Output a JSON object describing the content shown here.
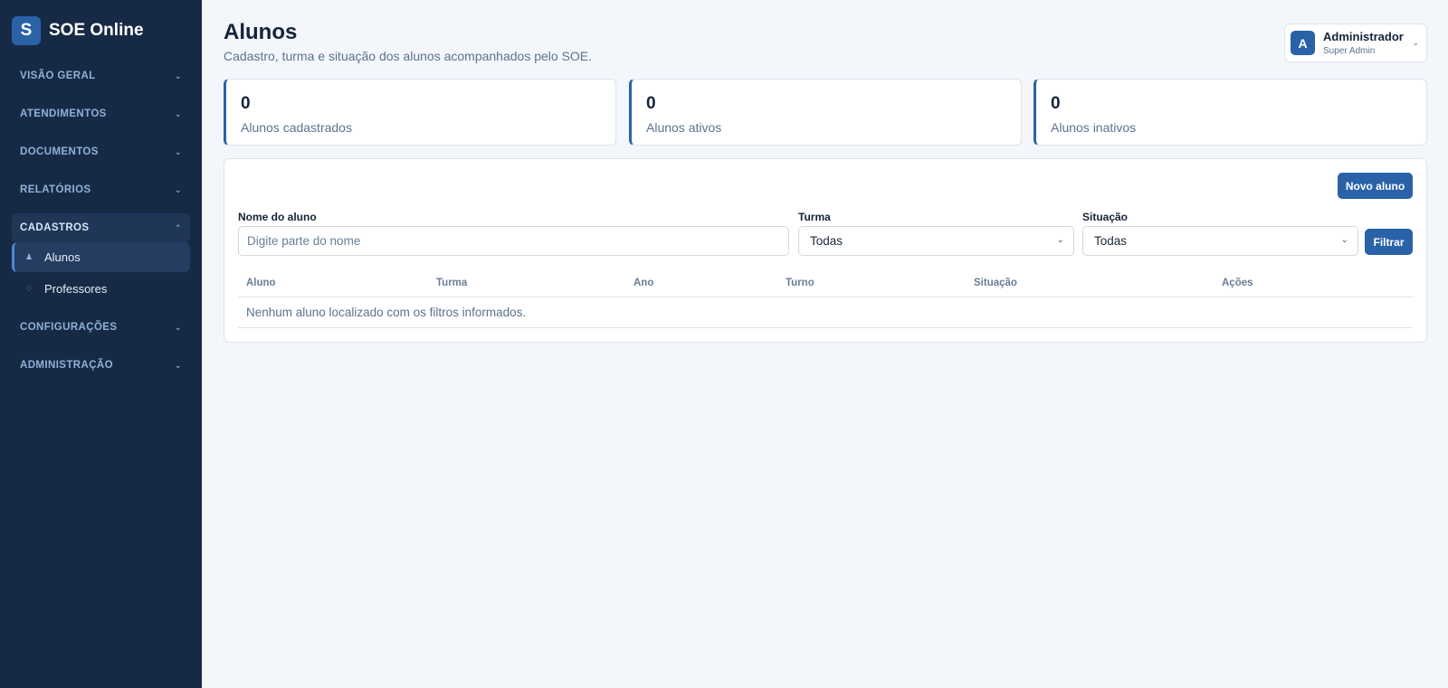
{
  "brand": {
    "logo_letter": "S",
    "name": "SOE Online"
  },
  "sidebar": {
    "sections": [
      {
        "label": "VISÃO GERAL",
        "chevron": "⌄"
      },
      {
        "label": "ATENDIMENTOS",
        "chevron": "⌄"
      },
      {
        "label": "DOCUMENTOS",
        "chevron": "⌄"
      },
      {
        "label": "RELATÓRIOS",
        "chevron": "⌄"
      },
      {
        "label": "CADASTROS",
        "chevron": "⌃"
      },
      {
        "label": "CONFIGURAÇÕES",
        "chevron": "⌄"
      },
      {
        "label": "ADMINISTRAÇÃO",
        "chevron": "⌄"
      }
    ],
    "cadastros_items": [
      {
        "label": "Alunos",
        "icon": "person-icon",
        "glyph": "♟"
      },
      {
        "label": "Professores",
        "icon": "teacher-icon",
        "glyph": "♢"
      }
    ]
  },
  "header": {
    "title": "Alunos",
    "subtitle": "Cadastro, turma e situação dos alunos acompanhados pelo SOE."
  },
  "user": {
    "avatar_letter": "A",
    "name": "Administrador",
    "role": "Super Admin",
    "chevron": "⌄"
  },
  "stats": [
    {
      "value": "0",
      "label": "Alunos cadastrados"
    },
    {
      "value": "0",
      "label": "Alunos ativos"
    },
    {
      "value": "0",
      "label": "Alunos inativos"
    }
  ],
  "actions": {
    "new_student": "Novo aluno",
    "filter": "Filtrar"
  },
  "filters": {
    "name_label": "Nome do aluno",
    "name_placeholder": "Digite parte do nome",
    "name_value": "",
    "class_label": "Turma",
    "class_value": "Todas",
    "status_label": "Situação",
    "status_value": "Todas",
    "select_chevron": "⌄"
  },
  "table": {
    "columns": [
      "Aluno",
      "Turma",
      "Ano",
      "Turno",
      "Situação",
      "Ações"
    ],
    "empty_message": "Nenhum aluno localizado com os filtros informados."
  },
  "colors": {
    "sidebar_bg": "#172a45",
    "accent": "#2a62a8",
    "page_bg": "#f3f6fa"
  }
}
